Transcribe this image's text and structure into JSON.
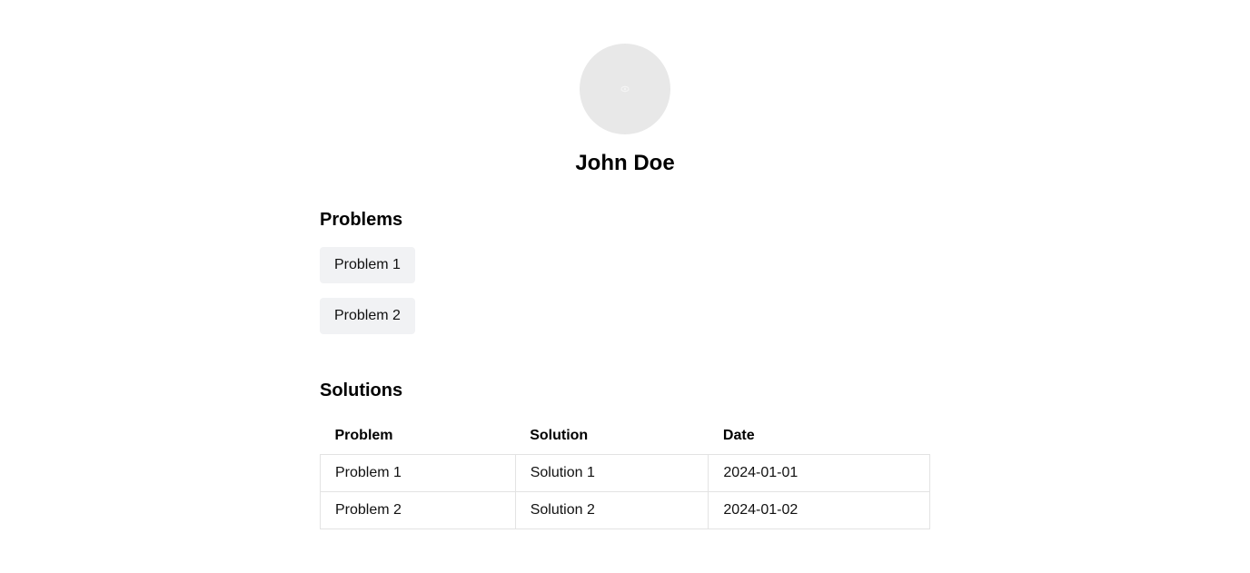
{
  "profile": {
    "name": "John Doe",
    "avatar_icon": "image-placeholder-icon"
  },
  "problems": {
    "heading": "Problems",
    "items": [
      {
        "label": "Problem 1"
      },
      {
        "label": "Problem 2"
      }
    ]
  },
  "solutions": {
    "heading": "Solutions",
    "columns": [
      "Problem",
      "Solution",
      "Date"
    ],
    "rows": [
      {
        "problem": "Problem 1",
        "solution": "Solution 1",
        "date": "2024-01-01"
      },
      {
        "problem": "Problem 2",
        "solution": "Solution 2",
        "date": "2024-01-02"
      }
    ]
  },
  "colors": {
    "avatar_bg": "#e8e8e8",
    "chip_bg": "#f1f2f4",
    "table_border": "#e3e3e3"
  }
}
